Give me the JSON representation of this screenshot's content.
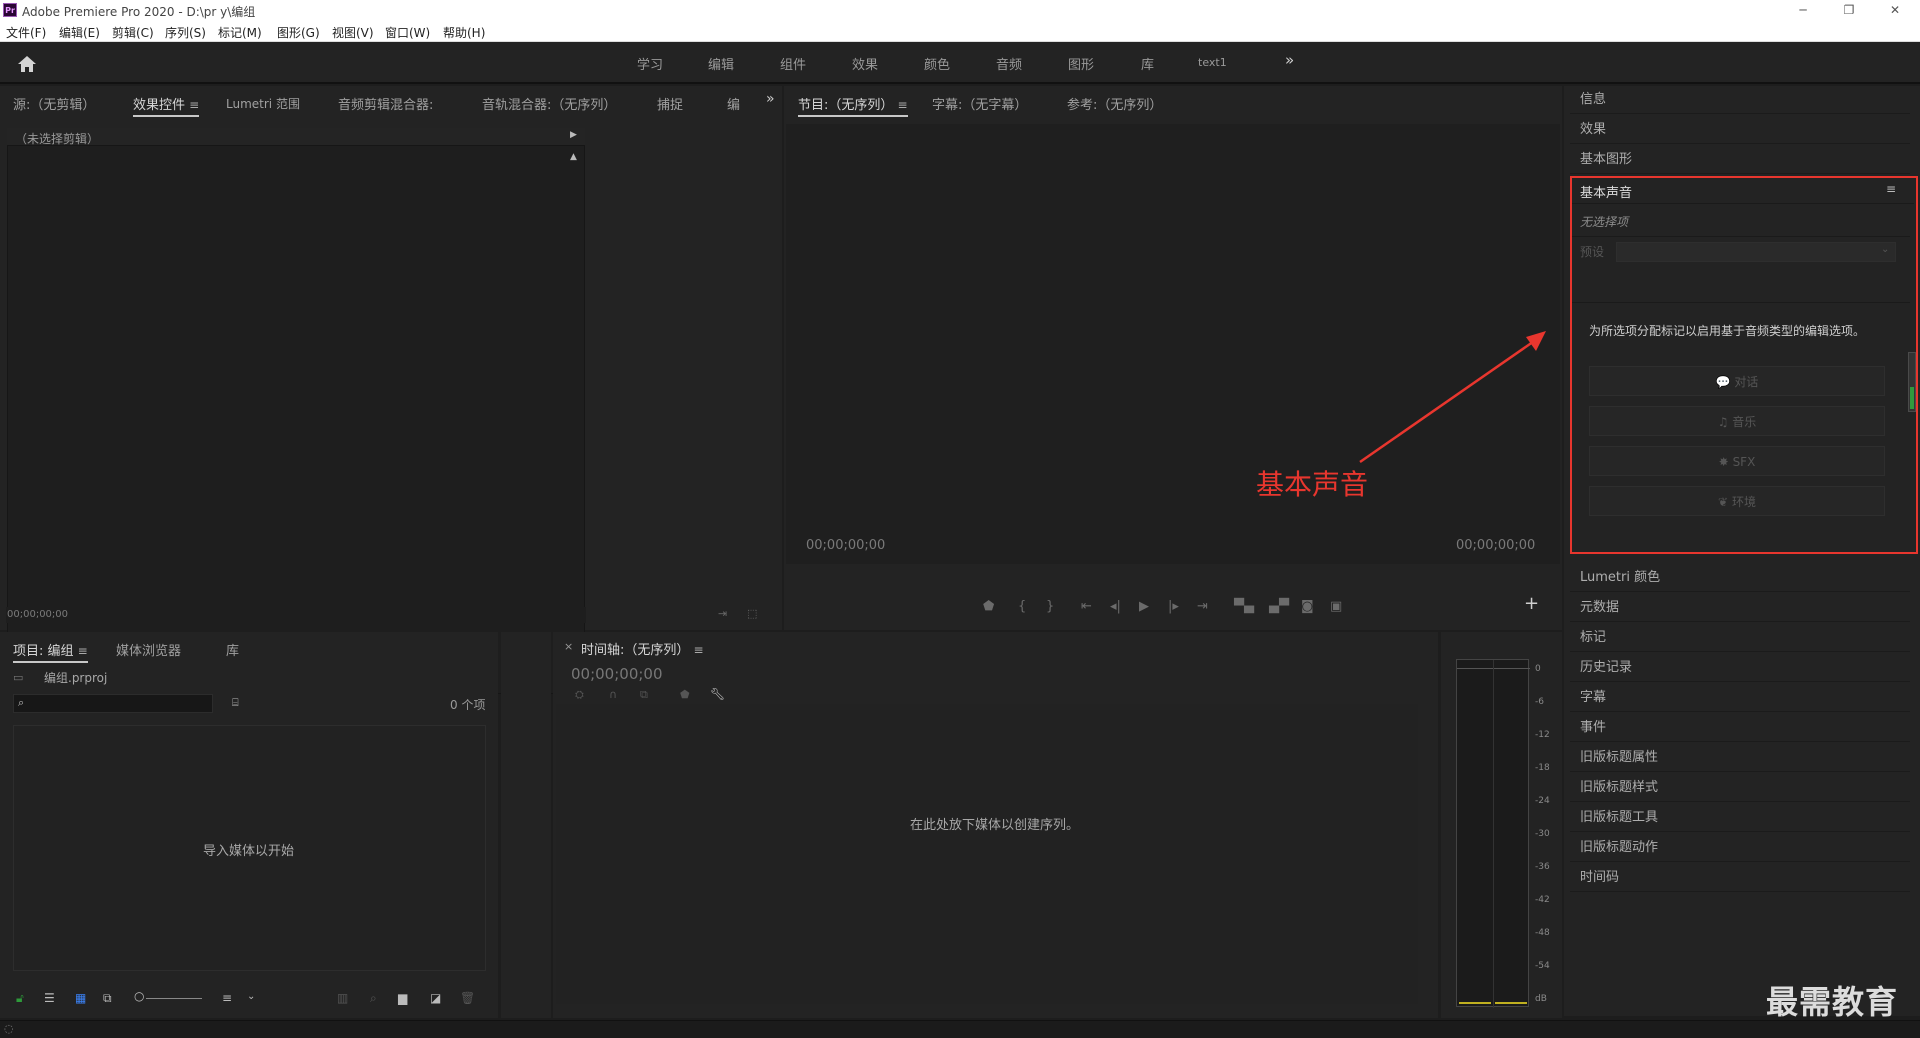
{
  "app": {
    "logo": "Pr",
    "title": "Adobe Premiere Pro 2020 - D:\\pr y\\编组",
    "window_controls": [
      "─",
      "❐",
      "✕"
    ]
  },
  "menu": [
    "文件(F)",
    "编辑(E)",
    "剪辑(C)",
    "序列(S)",
    "标记(M)",
    "图形(G)",
    "视图(V)",
    "窗口(W)",
    "帮助(H)"
  ],
  "workspaces": [
    "学习",
    "编辑",
    "组件",
    "效果",
    "颜色",
    "音频",
    "图形",
    "库",
    "text1"
  ],
  "workspace_more": "»",
  "source_panel": {
    "tabs": [
      "源:（无剪辑）",
      "效果控件",
      "Lumetri 范围",
      "音频剪辑混合器:",
      "音轨混合器:（无序列）",
      "捕捉",
      "编"
    ],
    "more": "»",
    "no_clip": "（未选择剪辑）",
    "timecode": "00;00;00;00"
  },
  "program_panel": {
    "tabs": [
      "节目:（无序列）",
      "字幕:（无字幕）",
      "参考:（无序列）"
    ],
    "timecode_left": "00;00;00;00",
    "timecode_right": "00;00;00;00",
    "add": "+"
  },
  "right_panel": {
    "items_top": [
      "信息",
      "效果",
      "基本图形"
    ],
    "essential_sound": {
      "title": "基本声音",
      "no_selection": "无选择项",
      "preset_label": "预设",
      "hint": "为所选项分配标记以启用基于音频类型的编辑选项。",
      "buttons": [
        "对话",
        "音乐",
        "SFX",
        "环境"
      ]
    },
    "items_bottom": [
      "Lumetri 颜色",
      "元数据",
      "标记",
      "历史记录",
      "字幕",
      "事件",
      "旧版标题属性",
      "旧版标题样式",
      "旧版标题工具",
      "旧版标题动作",
      "时间码"
    ]
  },
  "annotation": {
    "label": "基本声音",
    "color": "#e8362e"
  },
  "project_panel": {
    "tabs": [
      "项目: 编组",
      "媒体浏览器",
      "库"
    ],
    "file": "编组.prproj",
    "item_count": "0 个项",
    "empty_hint": "导入媒体以开始"
  },
  "timeline_panel": {
    "close": "×",
    "tab": "时间轴:（无序列）",
    "timecode": "00;00;00;00",
    "empty_hint": "在此处放下媒体以创建序列。"
  },
  "audio_meter": {
    "ticks": [
      "0",
      "-6",
      "-12",
      "-18",
      "-24",
      "-30",
      "-36",
      "-42",
      "-48",
      "-54",
      "dB"
    ]
  },
  "watermark": "最需教育"
}
